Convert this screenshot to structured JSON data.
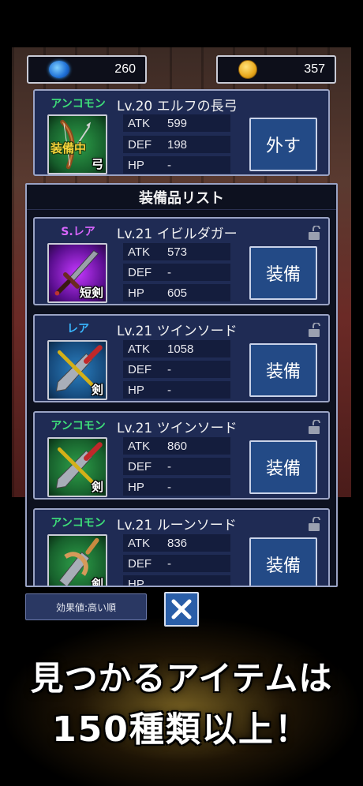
{
  "currency": {
    "gems": {
      "icon": "gem-icon",
      "value": "260"
    },
    "coins": {
      "icon": "coin-icon",
      "value": "357"
    }
  },
  "equipped": {
    "rarity": "アンコモン",
    "rarity_color": "#3ee07a",
    "title": "Lv.20 エルフの長弓",
    "tag": "装備中",
    "weapon_type": "弓",
    "stats": [
      {
        "label": "ATK",
        "value": "599"
      },
      {
        "label": "DEF",
        "value": "198"
      },
      {
        "label": "HP",
        "value": "-"
      }
    ],
    "button_label": "外す"
  },
  "list": {
    "header": "装備品リスト",
    "items": [
      {
        "rarity": "S.レア",
        "rarity_color": "#d966ff",
        "title": "Lv.21 イビルダガー",
        "weapon_type": "短剣",
        "icon_bg": "purple",
        "stats": [
          {
            "label": "ATK",
            "value": "573"
          },
          {
            "label": "DEF",
            "value": "-"
          },
          {
            "label": "HP",
            "value": "605"
          }
        ],
        "button_label": "装備"
      },
      {
        "rarity": "レア",
        "rarity_color": "#39b6ff",
        "title": "Lv.21 ツインソード",
        "weapon_type": "剣",
        "icon_bg": "blue",
        "stats": [
          {
            "label": "ATK",
            "value": "1058"
          },
          {
            "label": "DEF",
            "value": "-"
          },
          {
            "label": "HP",
            "value": "-"
          }
        ],
        "button_label": "装備"
      },
      {
        "rarity": "アンコモン",
        "rarity_color": "#3ee07a",
        "title": "Lv.21 ツインソード",
        "weapon_type": "剣",
        "icon_bg": "green",
        "stats": [
          {
            "label": "ATK",
            "value": "860"
          },
          {
            "label": "DEF",
            "value": "-"
          },
          {
            "label": "HP",
            "value": "-"
          }
        ],
        "button_label": "装備"
      },
      {
        "rarity": "アンコモン",
        "rarity_color": "#3ee07a",
        "title": "Lv.21 ルーンソード",
        "weapon_type": "剣",
        "icon_bg": "green",
        "stats": [
          {
            "label": "ATK",
            "value": "836"
          },
          {
            "label": "DEF",
            "value": "-"
          },
          {
            "label": "HP",
            "value": ""
          }
        ],
        "button_label": "装備"
      }
    ]
  },
  "footer": {
    "sort_label": "効果値:高い順",
    "close_icon": "close-icon"
  },
  "promo": {
    "line1": "見つかるアイテムは",
    "line2": "150種類以上！"
  }
}
